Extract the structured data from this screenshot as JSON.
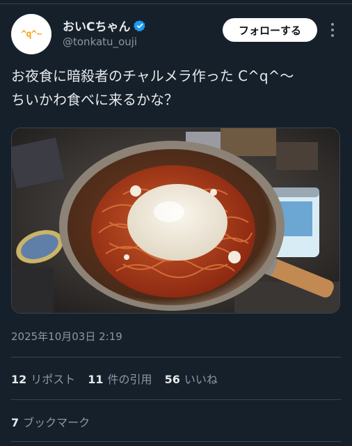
{
  "user": {
    "avatar_text": "^q^~",
    "display_name": "おいCちゃん",
    "handle": "@tonkatu_ouji",
    "verified": true
  },
  "actions": {
    "follow_label": "フォローする"
  },
  "tweet": {
    "text": "お夜食に暗殺者のチャルメラ作った C^q^〜\nちいかわ食べに来るかな？",
    "timestamp": "2025年10月03日 2:19"
  },
  "stats": {
    "reposts": {
      "count": "12",
      "label": "リポスト"
    },
    "quotes": {
      "count": "11",
      "label": "件の引用"
    },
    "likes": {
      "count": "56",
      "label": "いいね"
    },
    "bookmarks": {
      "count": "7",
      "label": "ブックマーク"
    }
  },
  "icons": {
    "verified": "verified-badge-icon",
    "more": "more-vertical-icon"
  },
  "colors": {
    "background": "#15202b",
    "accent": "#1d9bf0",
    "secondary_text": "#8b98a5"
  }
}
